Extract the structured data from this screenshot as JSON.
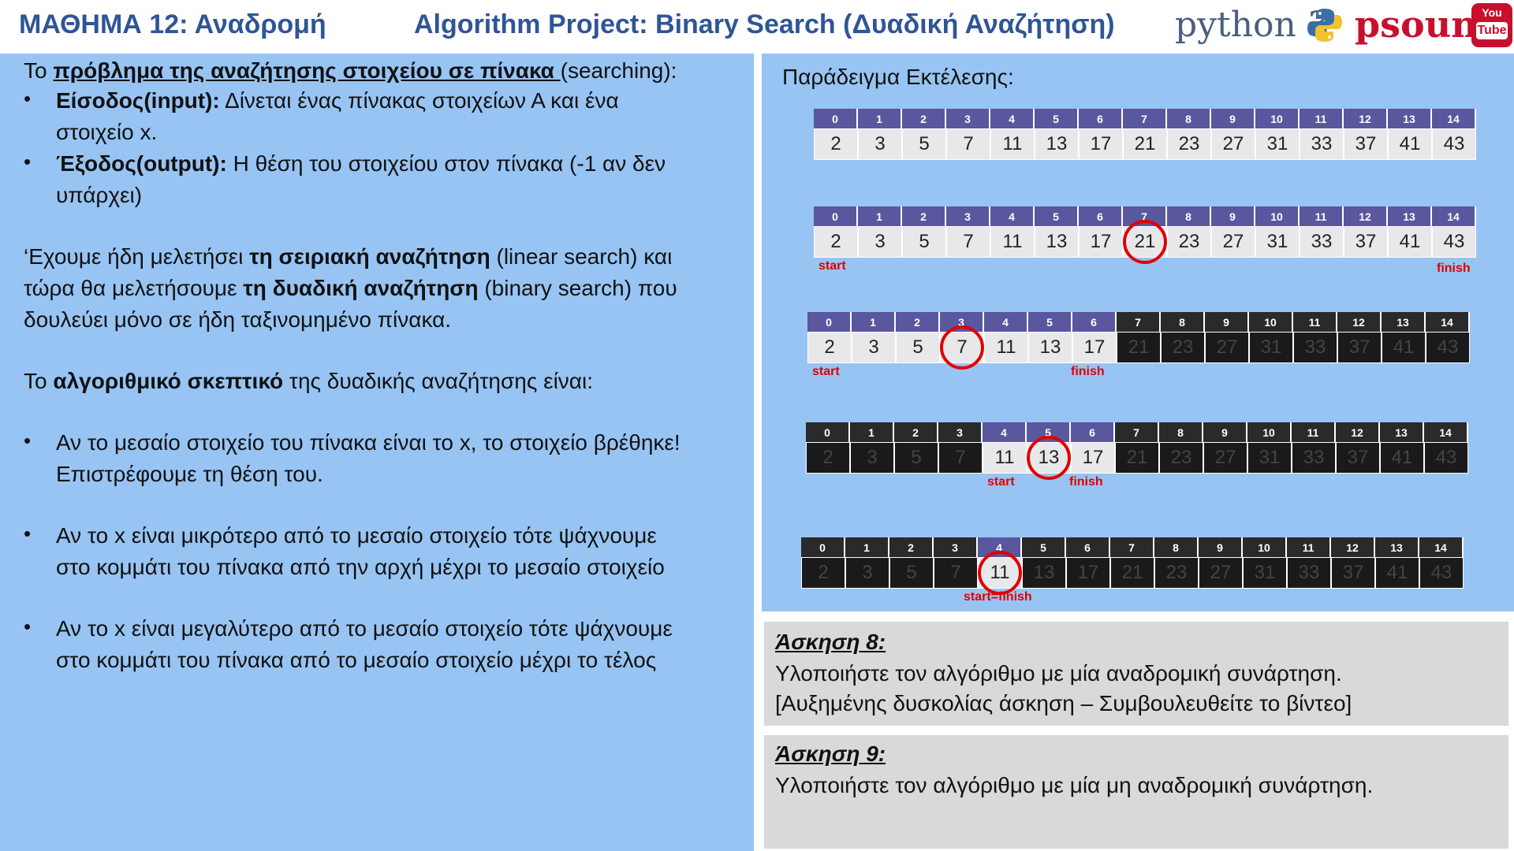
{
  "header": {
    "lesson": "ΜΑΘΗΜΑ 12: Αναδρομή",
    "project": "Algorithm Project: Binary Search (Δυαδική Αναζήτηση)",
    "python_logo": "python 3",
    "brand": "psounis",
    "youtube_top": "You",
    "youtube_bottom": "Tube"
  },
  "left": {
    "l1_pre": "Το ",
    "l1_bold": "πρόβλημα της αναζήτησης στοιχείου σε πίνακα ",
    "l1_post": "(searching):",
    "b1_bold": "Είσοδος(input):",
    "b1_text": " Δίνεται ένας πίνακας στοιχείων Α και ένα",
    "b1_cont": "στοιχείο x.",
    "b2_bold": "Έξοδος(output):",
    "b2_text": " Η θέση του στοιχείου στον πίνακα (-1 αν δεν",
    "b2_cont": "υπάρχει)",
    "p2_l1_pre": "‘Εχουμε ήδη μελετήσει ",
    "p2_l1_bold": "τη σειριακή αναζήτηση",
    "p2_l1_post": " (linear search) και",
    "p2_l2_pre": "τώρα θα μελετήσουμε ",
    "p2_l2_bold": "τη δυαδική αναζήτηση",
    "p2_l2_post": " (binary search) που",
    "p2_l3": "δουλεύει μόνο σε ήδη ταξινομημένο πίνακα.",
    "p3_pre": "Το ",
    "p3_bold": "αλγοριθμικό σκεπτικό",
    "p3_post": " της δυαδικής αναζήτησης είναι:",
    "r1_l1": "Αν το μεσαίο στοιχείο του πίνακα είναι το x, το στοιχείο βρέθηκε!",
    "r1_l2": "Επιστρέφουμε τη θέση του.",
    "r2_l1": "Αν το x είναι μικρότερο από το μεσαίο στοιχείο τότε ψάχνουμε",
    "r2_l2": "στο κομμάτι του πίνακα από την αρχή μέχρι το μεσαίο στοιχείο",
    "r3_l1": "Αν το x είναι μεγαλύτερο από το μεσαίο στοιχείο τότε ψάχνουμε",
    "r3_l2": "στο κομμάτι του πίνακα από το μεσαίο στοιχείο μέχρι το τέλος",
    "bullet": "•"
  },
  "example": {
    "title": "Παράδειγμα Εκτέλεσης:",
    "indices": [
      "0",
      "1",
      "2",
      "3",
      "4",
      "5",
      "6",
      "7",
      "8",
      "9",
      "10",
      "11",
      "12",
      "13",
      "14"
    ],
    "values": [
      "2",
      "3",
      "5",
      "7",
      "11",
      "13",
      "17",
      "21",
      "23",
      "27",
      "31",
      "33",
      "37",
      "41",
      "43"
    ],
    "steps": [
      {
        "active_from": 0,
        "active_to": 14,
        "circled": null,
        "index_highlight": [
          0,
          14
        ],
        "start_label": null,
        "finish_label": null
      },
      {
        "active_from": 0,
        "active_to": 14,
        "circled": 7,
        "index_highlight": [
          0,
          14
        ],
        "start_label": "start",
        "finish_label": "finish"
      },
      {
        "active_from": 0,
        "active_to": 6,
        "circled": 3,
        "index_highlight": [
          0,
          6
        ],
        "start_label": "start",
        "finish_label": "finish"
      },
      {
        "active_from": 4,
        "active_to": 6,
        "circled": 5,
        "index_highlight": [
          4,
          6
        ],
        "start_label": "start",
        "finish_label": "finish"
      },
      {
        "active_from": 4,
        "active_to": 4,
        "circled": 4,
        "index_highlight": [
          4,
          4
        ],
        "start_label": "start=finish",
        "finish_label": null
      }
    ]
  },
  "exercises": {
    "ex8_title": "Άσκηση 8:",
    "ex8_l1": "Υλοποιήστε τον αλγόριθμο με μία αναδρομική συνάρτηση.",
    "ex8_l2": "[Αυξημένης δυσκολίας άσκηση – Συμβουλευθείτε το βίντεο]",
    "ex9_title": "Άσκηση 9:",
    "ex9_l1": "Υλοποιήστε τον αλγόριθμο με μία μη αναδρομική συνάρτηση."
  },
  "colors": {
    "panel_blue": "#97c4f3",
    "title_blue": "#2f5597",
    "index_active": "#5a579e",
    "marker_red": "#e00000",
    "brand_red": "#c8102e"
  }
}
